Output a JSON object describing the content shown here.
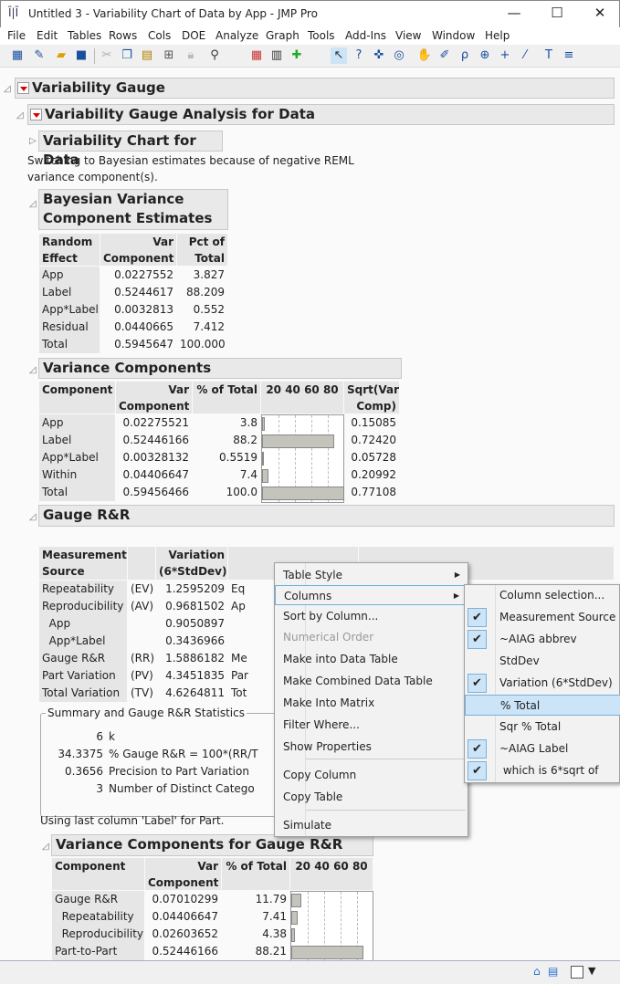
{
  "window": {
    "title": "Untitled 3 - Variability Chart of Data by App - JMP Pro",
    "minimize": "—",
    "maximize": "☐",
    "close": "✕"
  },
  "menu": [
    "File",
    "Edit",
    "Tables",
    "Rows",
    "Cols",
    "DOE",
    "Analyze",
    "Graph",
    "Tools",
    "Add-Ins",
    "View",
    "Window",
    "Help"
  ],
  "outline": {
    "root": "Variability Gauge",
    "analysis": "Variability Gauge Analysis for Data",
    "chart": "Variability Chart for Data",
    "note1": "Switching to Bayesian estimates because of negative REML",
    "note2": "variance component(s).",
    "bayes1": "Bayesian Variance",
    "bayes2": "Component Estimates",
    "varcomp": "Variance Components",
    "gauge": "Gauge R&R",
    "summary_title": "Summary and Gauge R&R Statistics",
    "using": "Using last column 'Label' for Part.",
    "vcgauge": "Variance Components for Gauge R&R"
  },
  "bayes_table": {
    "headers": [
      [
        "Random",
        "Effect"
      ],
      [
        "Var",
        "Component"
      ],
      [
        "Pct of",
        "Total"
      ]
    ],
    "rows": [
      [
        "App",
        "0.0227552",
        "3.827"
      ],
      [
        "Label",
        "0.5244617",
        "88.209"
      ],
      [
        "App*Label",
        "0.0032813",
        "0.552"
      ],
      [
        "Residual",
        "0.0440665",
        "7.412"
      ],
      [
        "Total",
        "0.5945647",
        "100.000"
      ]
    ]
  },
  "varcomp_table": {
    "headers": [
      [
        "",
        "Component"
      ],
      [
        "Var",
        "Component"
      ],
      [
        "",
        "% of Total"
      ],
      [
        "",
        "20 40 60 80"
      ],
      [
        "Sqrt(Var",
        "Comp)"
      ]
    ],
    "rows": [
      [
        "App",
        "0.02275521",
        "3.8",
        3.8,
        "0.15085"
      ],
      [
        "Label",
        "0.52446166",
        "88.2",
        88.2,
        "0.72420"
      ],
      [
        "App*Label",
        "0.00328132",
        "0.5519",
        0.5519,
        "0.05728"
      ],
      [
        "Within",
        "0.04406647",
        "7.4",
        7.4,
        "0.20992"
      ],
      [
        "Total",
        "0.59456466",
        "100.0",
        100,
        "0.77108"
      ]
    ]
  },
  "gauge_table": {
    "headers": [
      [
        "Measurement",
        "Source"
      ],
      [
        "",
        ""
      ],
      [
        "Variation",
        "(6*StdDev)"
      ],
      [
        "",
        ""
      ],
      [
        "",
        ""
      ]
    ],
    "rows": [
      [
        "Repeatability",
        "(EV)",
        "1.2595209",
        "Eq",
        ""
      ],
      [
        "Reproducibility",
        "(AV)",
        "0.9681502",
        "Ap",
        ""
      ],
      [
        "  App",
        "",
        "0.9050897",
        "",
        ""
      ],
      [
        "  App*Label",
        "",
        "0.3436966",
        "",
        ""
      ],
      [
        "Gauge R&R",
        "(RR)",
        "1.5886182",
        "Me",
        ""
      ],
      [
        "Part Variation",
        "(PV)",
        "4.3451835",
        "Par",
        ""
      ],
      [
        "Total Variation",
        "(TV)",
        "4.6264811",
        "Tot",
        ""
      ]
    ]
  },
  "summary": [
    [
      "6",
      "k"
    ],
    [
      "34.3375",
      "% Gauge R&R = 100*(RR/T"
    ],
    [
      "0.3656",
      "Precision to Part Variation"
    ],
    [
      "3",
      "Number of Distinct Catego"
    ]
  ],
  "vcgauge_table": {
    "headers": [
      [
        "",
        "Component"
      ],
      [
        "Var",
        "Component"
      ],
      [
        "",
        "% of Total"
      ],
      [
        "",
        "20 40 60 80"
      ]
    ],
    "rows": [
      [
        "Gauge R&R",
        "0.07010299",
        "11.79",
        11.79
      ],
      [
        "  Repeatability",
        "0.04406647",
        "7.41",
        7.41
      ],
      [
        "  Reproducibility",
        "0.02603652",
        "4.38",
        4.38
      ],
      [
        "Part-to-Part",
        "0.52446166",
        "88.21",
        88.21
      ]
    ]
  },
  "context_menu": {
    "items": [
      "Table Style",
      "Columns",
      "Sort by Column...",
      "Numerical Order",
      "Make into Data Table",
      "Make Combined Data Table",
      "Make Into Matrix",
      "Filter Where...",
      "Show Properties",
      "Copy Column",
      "Copy Table",
      "Simulate"
    ]
  },
  "columns_submenu": {
    "items": [
      {
        "label": "Column selection...",
        "checked": false
      },
      {
        "label": "Measurement Source",
        "checked": true
      },
      {
        "label": "~AIAG abbrev",
        "checked": true
      },
      {
        "label": "StdDev",
        "checked": false
      },
      {
        "label": "Variation (6*StdDev)",
        "checked": true
      },
      {
        "label": "% Total",
        "checked": false
      },
      {
        "label": "Sqr % Total",
        "checked": false
      },
      {
        "label": "~AIAG Label",
        "checked": true
      },
      {
        "label": " which is 6*sqrt of",
        "checked": true
      }
    ]
  },
  "colors": {
    "bar": "#c4c4bc",
    "highlight": "#cce4f7",
    "header": "#e9e9e9"
  }
}
